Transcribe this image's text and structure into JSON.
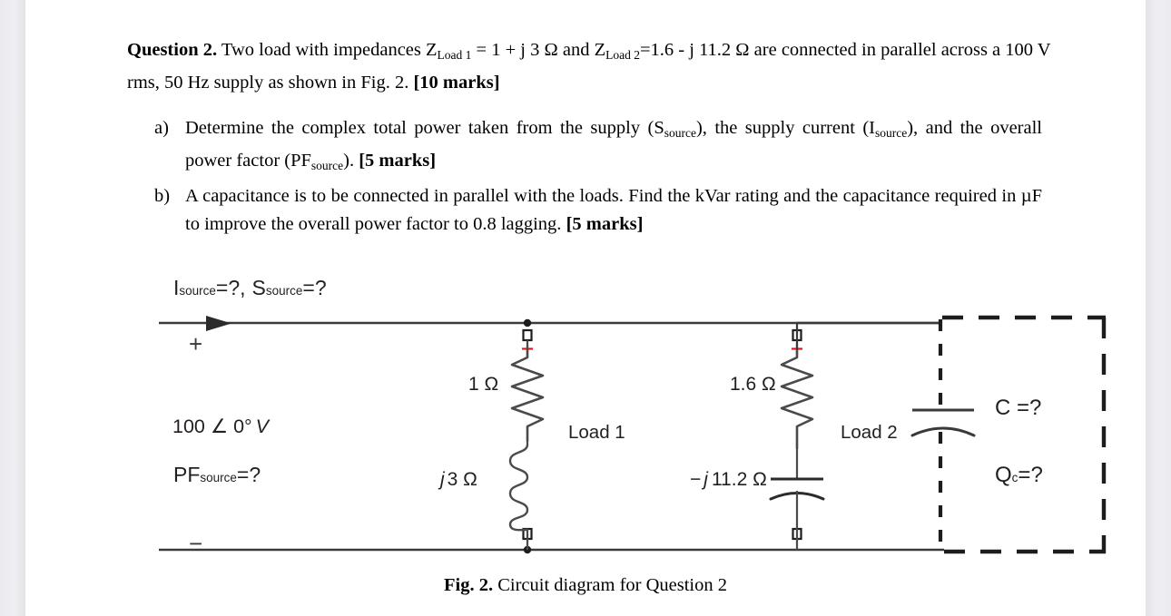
{
  "document": {
    "question": {
      "number_label": "Question 2.",
      "body_before_sub1": " Two load with impedances Z",
      "sub1": "Load 1",
      "body_mid": " = 1 + j 3 Ω and Z",
      "sub2": "Load 2",
      "body_after": "=1.6 - j 11.2 Ω are connected in parallel across a 100 V rms, 50 Hz supply as shown in Fig. 2. ",
      "marks": "[10 marks]"
    },
    "parts": [
      {
        "marker": "a)",
        "text_1": "Determine the complex total power taken from the supply (S",
        "sub_1": "source",
        "text_2": "), the supply current (I",
        "sub_2": "source",
        "text_3": "), and the overall power factor (PF",
        "sub_3": "source",
        "text_4": "). ",
        "marks": "[5 marks]"
      },
      {
        "marker": "b)",
        "text_1": "A capacitance is to be connected in parallel with the loads. Find the kVar rating and the capacitance required in µF to improve the overall power factor to 0.8 lagging. ",
        "marks": "[5 marks]"
      }
    ],
    "caption": {
      "bold": "Fig. 2.",
      "text": " Circuit diagram for Question 2"
    }
  },
  "circuit": {
    "labels": {
      "source_current": "I",
      "source_current_sub": "source",
      "source_current_eq": "=?",
      "comma": ",",
      "source_power": "S",
      "source_power_sub": "source",
      "source_power_eq": "=?",
      "plus_terminal": "+",
      "minus_terminal": "−",
      "supply_voltage": "100 ∠ 0°",
      "supply_voltage_unit": "V",
      "pf_source": "PF",
      "pf_source_sub": "source",
      "pf_source_eq": "=?",
      "load1_resistor": "1 Ω",
      "load1_inductor_j": "j",
      "load1_inductor_val": "3 Ω",
      "load1_name": "Load 1",
      "load2_resistor": "1.6 Ω",
      "load2_cap_sign": "−",
      "load2_cap_j": "j",
      "load2_cap_val": "11.2 Ω",
      "load2_name": "Load 2",
      "capacitor_value": "C =?",
      "capacitor_q": "Q",
      "capacitor_q_sub": "c",
      "capacitor_q_eq": "=?"
    },
    "colors": {
      "wire": "#3a3a3a",
      "component": "#4a4a4a",
      "polarity_marker": "#e8131a",
      "text": "#231f20",
      "page_background": "#ffffff",
      "margin_background": "#ececf0"
    }
  }
}
